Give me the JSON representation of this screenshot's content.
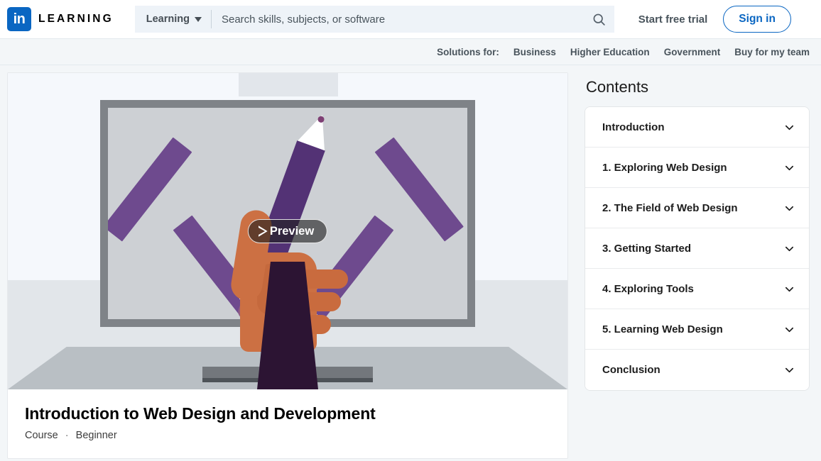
{
  "header": {
    "logo_glyph": "in",
    "brand_word": "LEARNING",
    "scope_label": "Learning",
    "scope_caret_icon": "chevron-down-icon",
    "search_placeholder": "Search skills, subjects, or software",
    "search_value": "",
    "search_icon": "search-icon",
    "start_trial_label": "Start free trial",
    "sign_in_label": "Sign in",
    "accent_color": "#0a66c2"
  },
  "sub_nav": {
    "label": "Solutions for:",
    "links": [
      {
        "label": "Business"
      },
      {
        "label": "Higher Education"
      },
      {
        "label": "Government"
      },
      {
        "label": "Buy for my team"
      }
    ]
  },
  "hero": {
    "preview_label": "Preview",
    "play_icon": "play-triangle-icon",
    "illustration_name": "person-drawing-code-brackets-on-monitor"
  },
  "course": {
    "title": "Introduction to Web Design and Development",
    "type": "Course",
    "separator": "·",
    "level": "Beginner"
  },
  "contents": {
    "heading": "Contents",
    "sections": [
      {
        "label": "Introduction",
        "toggle_icon": "chevron-down-icon"
      },
      {
        "label": "1. Exploring Web Design",
        "toggle_icon": "chevron-down-icon"
      },
      {
        "label": "2. The Field of Web Design",
        "toggle_icon": "chevron-down-icon"
      },
      {
        "label": "3. Getting Started",
        "toggle_icon": "chevron-down-icon"
      },
      {
        "label": "4. Exploring Tools",
        "toggle_icon": "chevron-down-icon"
      },
      {
        "label": "5. Learning Web Design",
        "toggle_icon": "chevron-down-icon"
      },
      {
        "label": "Conclusion",
        "toggle_icon": "chevron-down-icon"
      }
    ]
  },
  "colors": {
    "page_bg": "#f3f6f8",
    "card_bg": "#ffffff",
    "purple": "#6e4a8e",
    "skin": "#cc7043",
    "sleeve": "#2c1433",
    "monitor_frame": "#7f8388",
    "monitor_screen": "#cdd0d4"
  }
}
